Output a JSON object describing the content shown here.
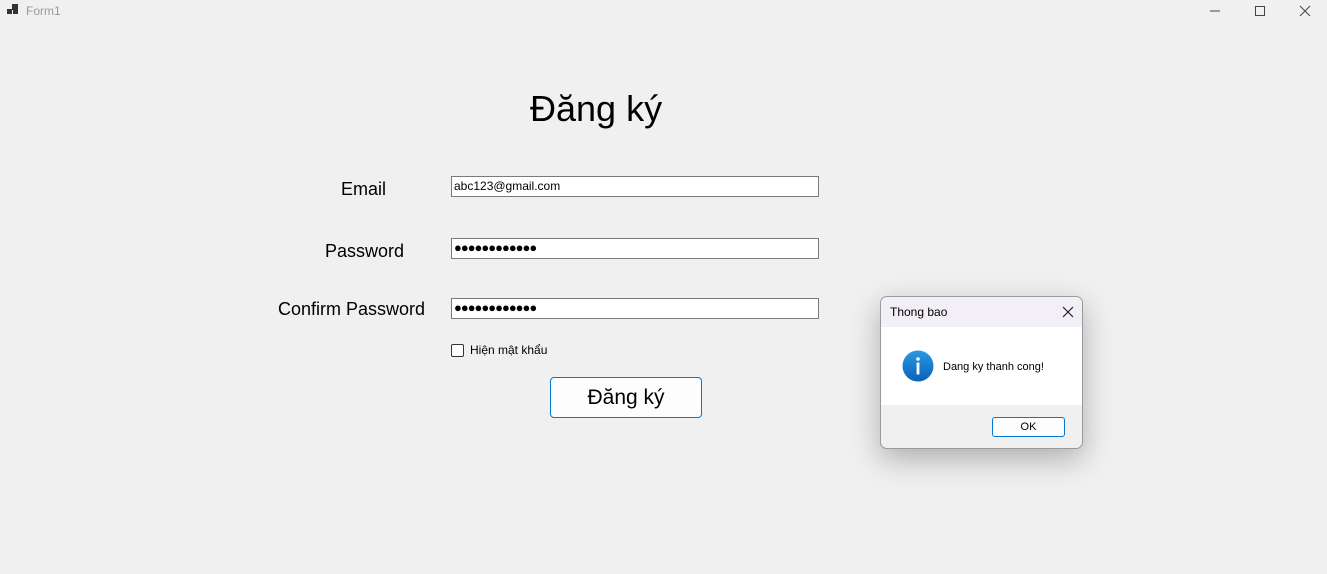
{
  "window": {
    "title": "Form1"
  },
  "form": {
    "heading": "Đăng ký",
    "email_label": "Email",
    "email_value": "abc123@gmail.com",
    "password_label": "Password",
    "password_value": "●●●●●●●●●●●●",
    "confirm_label": "Confirm Password",
    "confirm_value": "●●●●●●●●●●●●",
    "show_password_label": "Hiện mật khẩu",
    "show_password_checked": false,
    "submit_label": "Đăng ký"
  },
  "dialog": {
    "title": "Thong bao",
    "message": "Dang ky thanh cong!",
    "ok_label": "OK",
    "icon": "info-icon"
  },
  "colors": {
    "accent": "#0078d4",
    "background": "#f0f0f0",
    "dialog_title_bg": "#f3eff7"
  },
  "icons": {
    "app": "app-icon",
    "minimize": "minimize-icon",
    "maximize": "maximize-icon",
    "close": "close-icon"
  }
}
